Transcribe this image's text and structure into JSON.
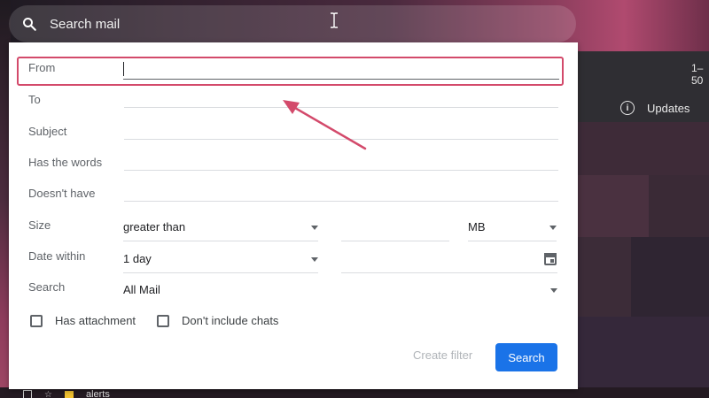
{
  "search_bar": {
    "label": "Search mail"
  },
  "background": {
    "counter": "1–50",
    "updates_label": "Updates",
    "bottom_text": "alerts"
  },
  "form": {
    "from": {
      "label": "From",
      "value": ""
    },
    "to": {
      "label": "To"
    },
    "subject": {
      "label": "Subject"
    },
    "has_words": {
      "label": "Has the words"
    },
    "doesnt_have": {
      "label": "Doesn't have"
    },
    "size": {
      "label": "Size",
      "comparator": "greater than",
      "unit": "MB"
    },
    "date_within": {
      "label": "Date within",
      "value": "1 day"
    },
    "search_in": {
      "label": "Search",
      "value": "All Mail"
    },
    "has_attachment": {
      "label": "Has attachment"
    },
    "dont_include_chats": {
      "label": "Don't include chats"
    },
    "create_filter": "Create filter",
    "search_button": "Search"
  },
  "colors": {
    "highlight": "#d34a6b",
    "primary": "#1a73e8"
  }
}
